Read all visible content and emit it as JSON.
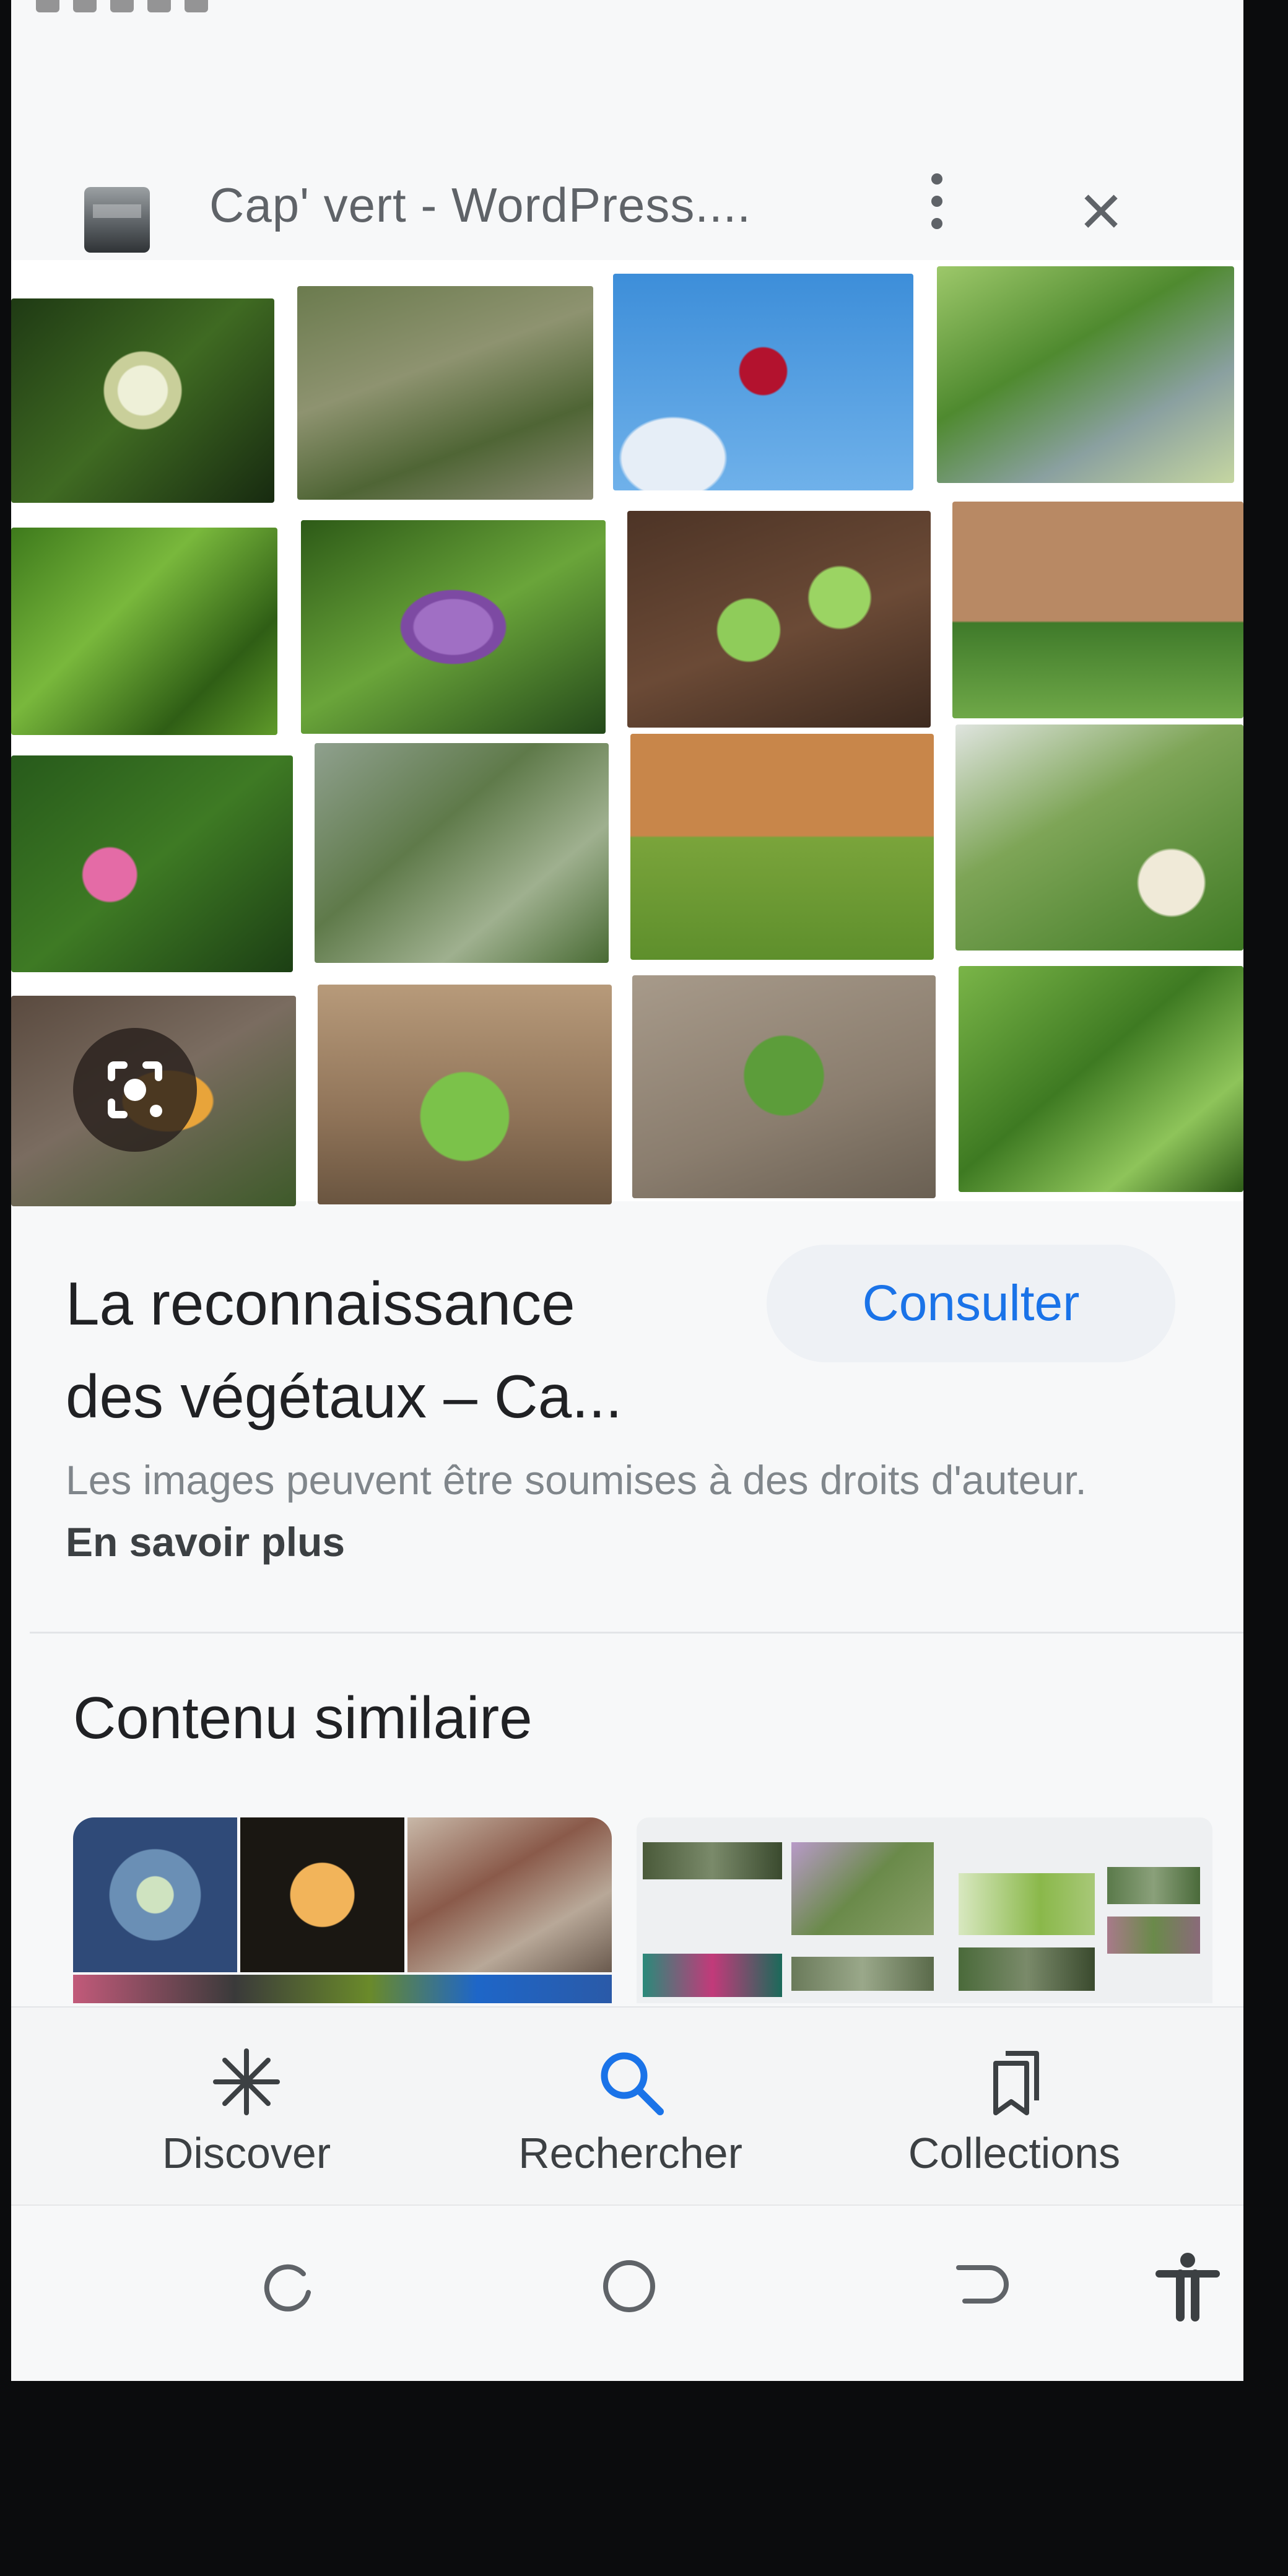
{
  "header": {
    "site_title": "Cap' vert - WordPress....",
    "favicon_icon": "site-favicon",
    "more_icon": "more-vertical-icon",
    "close_icon": "close-icon",
    "close_glyph": "×"
  },
  "image_result": {
    "lens_icon": "lens-search-icon",
    "title_line1": "La reconnaissance",
    "title_line2": "des végétaux – Ca...",
    "consult_label": "Consulter",
    "copyright_text": "Les images peuvent être soumises à des droits d'auteur.",
    "learn_more_label": "En savoir plus"
  },
  "similar": {
    "heading": "Contenu similaire"
  },
  "bottom_nav": {
    "items": [
      {
        "label": "Discover",
        "icon": "asterisk-icon"
      },
      {
        "label": "Rechercher",
        "icon": "search-icon"
      },
      {
        "label": "Collections",
        "icon": "collections-icon"
      }
    ],
    "active_color": "#1a73e8"
  },
  "system_nav": {
    "recents_icon": "recents-icon",
    "home_icon": "home-icon",
    "back_icon": "back-icon",
    "accessibility_icon": "accessibility-icon"
  },
  "colors": {
    "accent": "#1a73e8",
    "text_primary": "#202124",
    "text_secondary": "#80868b"
  }
}
